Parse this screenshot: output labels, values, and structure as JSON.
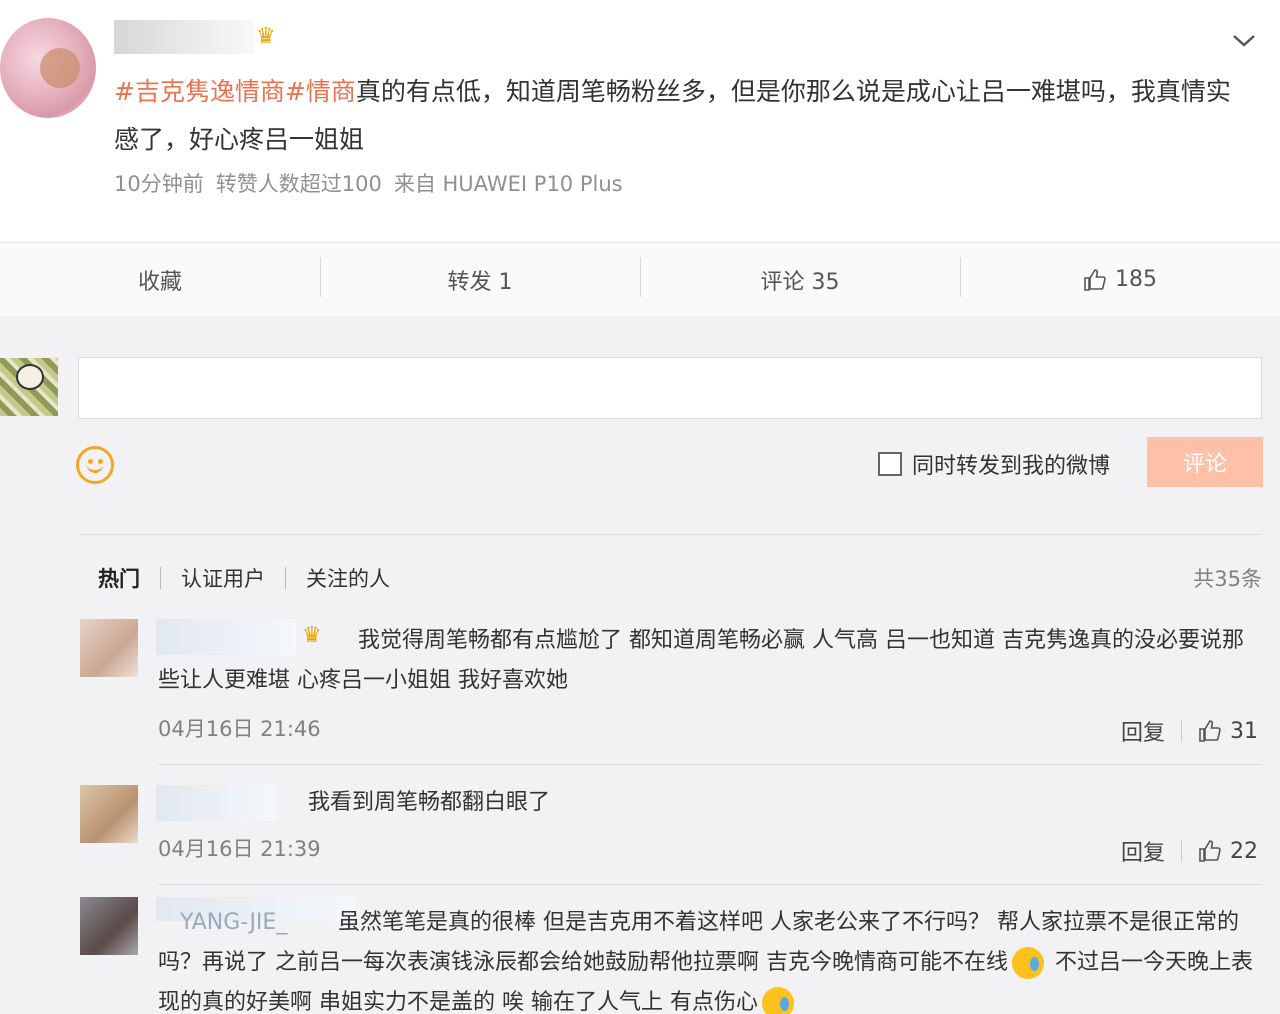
{
  "post": {
    "hashtag1": "#吉克隽逸情商#",
    "hashtag2": "情商",
    "text": "真的有点低，知道周笔畅粉丝多，但是你那么说是成心让吕一难堪吗，我真情实感了，好心疼吕一姐姐",
    "time": "10分钟前",
    "reposts_note": "转赞人数超过100",
    "source": "来自 HUAWEI P10 Plus"
  },
  "actions": {
    "favorite": "收藏",
    "repost": "转发 1",
    "comment": "评论 35",
    "like_count": "185"
  },
  "editor": {
    "checkbox_label": "同时转发到我的微博",
    "submit": "评论"
  },
  "list": {
    "tabs": [
      "热门",
      "认证用户",
      "关注的人"
    ],
    "total": "共35条"
  },
  "comments": [
    {
      "text": "我觉得周笔畅都有点尴尬了 都知道周笔畅必赢 人气高 吕一也知道 吉克隽逸真的没必要说那些让人更难堪 心疼吕一小姐姐 我好喜欢她",
      "time": "04月16日 21:46",
      "reply": "回复",
      "likes": "31"
    },
    {
      "text": "我看到周笔畅都翻白眼了",
      "time": "04月16日 21:39",
      "reply": "回复",
      "likes": "22"
    },
    {
      "name_partial": "YANG-JIE_",
      "text_a": "虽然笔笔是真的很棒 但是吉克用不着这样吧 人家老公来了不行吗？ 帮人家拉票不是很正常的吗？再说了 之前吕一每次表演钱泳辰都会给她鼓励帮他拉票啊 吉克今晚情商可能不在线",
      "text_b": " 不过吕一今天晚上表现的真的好美啊 串姐实力不是盖的 唉 输在了人气上 有点伤心"
    }
  ],
  "colors": {
    "hashtag": "#eb7350",
    "submit_bg": "#ffc0a8",
    "crown": "#e8a400",
    "emoji": "#f5a623"
  }
}
